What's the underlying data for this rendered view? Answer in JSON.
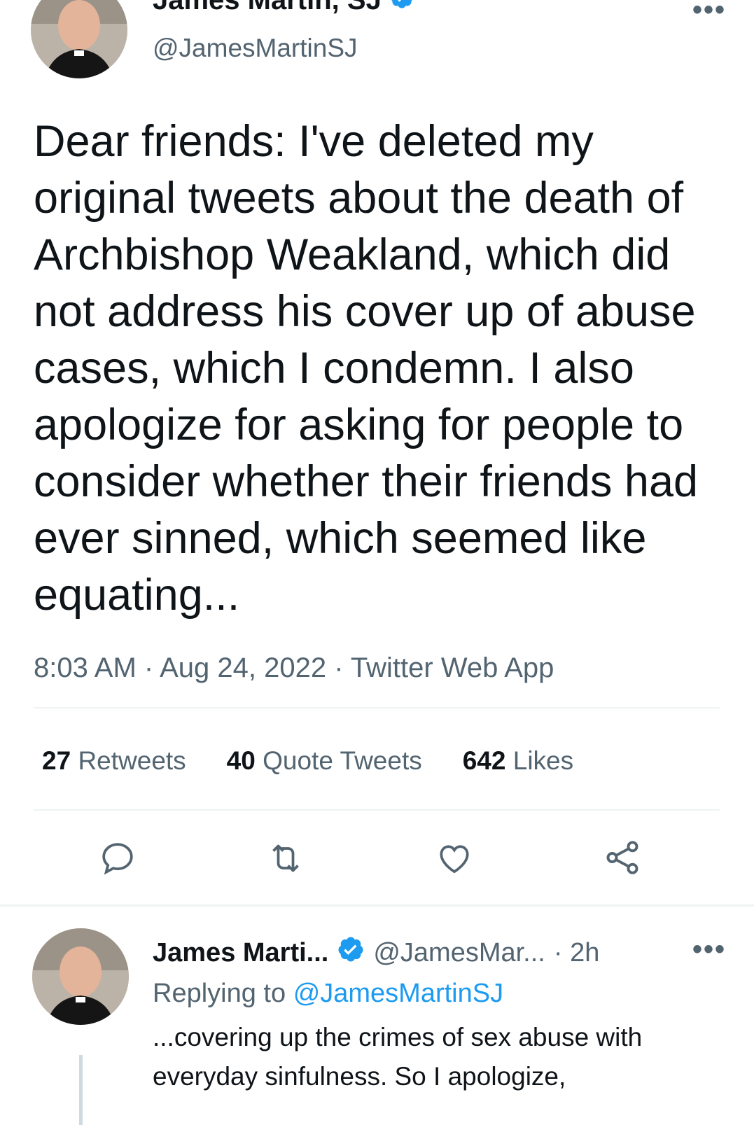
{
  "tweet": {
    "author_name": "James Martin, SJ",
    "author_handle": "@JamesMartinSJ",
    "more_label": "•••",
    "text": "Dear friends: I've deleted my original tweets about the death of Archbishop Weakland, which did not address his cover up of abuse cases, which I condemn. I also apologize for asking for people to consider whether their friends had ever sinned, which seemed like equating...",
    "timestamp": "8:03 AM · Aug 24, 2022 · Twitter Web App",
    "stats": {
      "retweets_count": "27",
      "retweets_label": "Retweets",
      "quotes_count": "40",
      "quotes_label": "Quote Tweets",
      "likes_count": "642",
      "likes_label": "Likes"
    },
    "actions": [
      "reply-icon",
      "retweet-icon",
      "like-icon",
      "share-icon"
    ]
  },
  "reply": {
    "author_name": "James Marti...",
    "author_handle": "@JamesMar...",
    "time": "· 2h",
    "more_label": "•••",
    "replying_prefix": "Replying to",
    "replying_handle": "@JamesMartinSJ",
    "text": "...covering up the crimes of sex abuse with everyday sinfulness. So I apologize,"
  },
  "colors": {
    "text": "#0f1419",
    "secondary": "#536471",
    "link": "#1d9bf0",
    "verified": "#1d9bf0",
    "divider": "#eff3f4"
  }
}
